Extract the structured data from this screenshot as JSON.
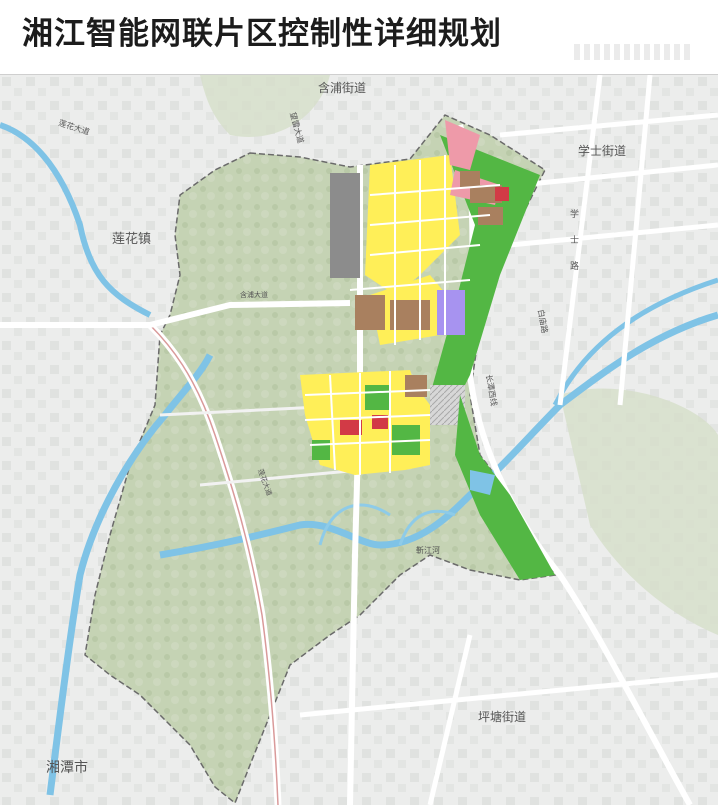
{
  "title": "湘江智能网联片区控制性详细规划",
  "places": {
    "hanpu": "含浦街道",
    "xueshi": "学士街道",
    "lianhua": "莲花镇",
    "pingtang": "坪塘街道",
    "xiangtan": "湘潭市"
  },
  "roads": {
    "lianhua_avenue": "莲花大道",
    "wangleng_avenue": "望雷大道",
    "xuefu_vert": "学",
    "xuefu_vert2": "士",
    "xuefu_vert3": "路",
    "baiyu": "白庙路",
    "changtan_west": "长潭西线",
    "jinxiang_left": "靳",
    "jinxiang_right": "江",
    "xiangpu_avenue": "含浦大道",
    "lianhua_road": "莲花大道",
    "river_name": "靳江河"
  },
  "colors": {
    "mountain": "#c9d6b8",
    "urban": "#e9ebe9",
    "river": "#7fc3e6",
    "residential": "#ffef58",
    "commercial": "#ee9aa9",
    "industrial": "#a9805f",
    "green": "#53b744",
    "public": "#a793f0",
    "plaza": "#c6c6c6",
    "boundary": "#6a6a6a"
  }
}
